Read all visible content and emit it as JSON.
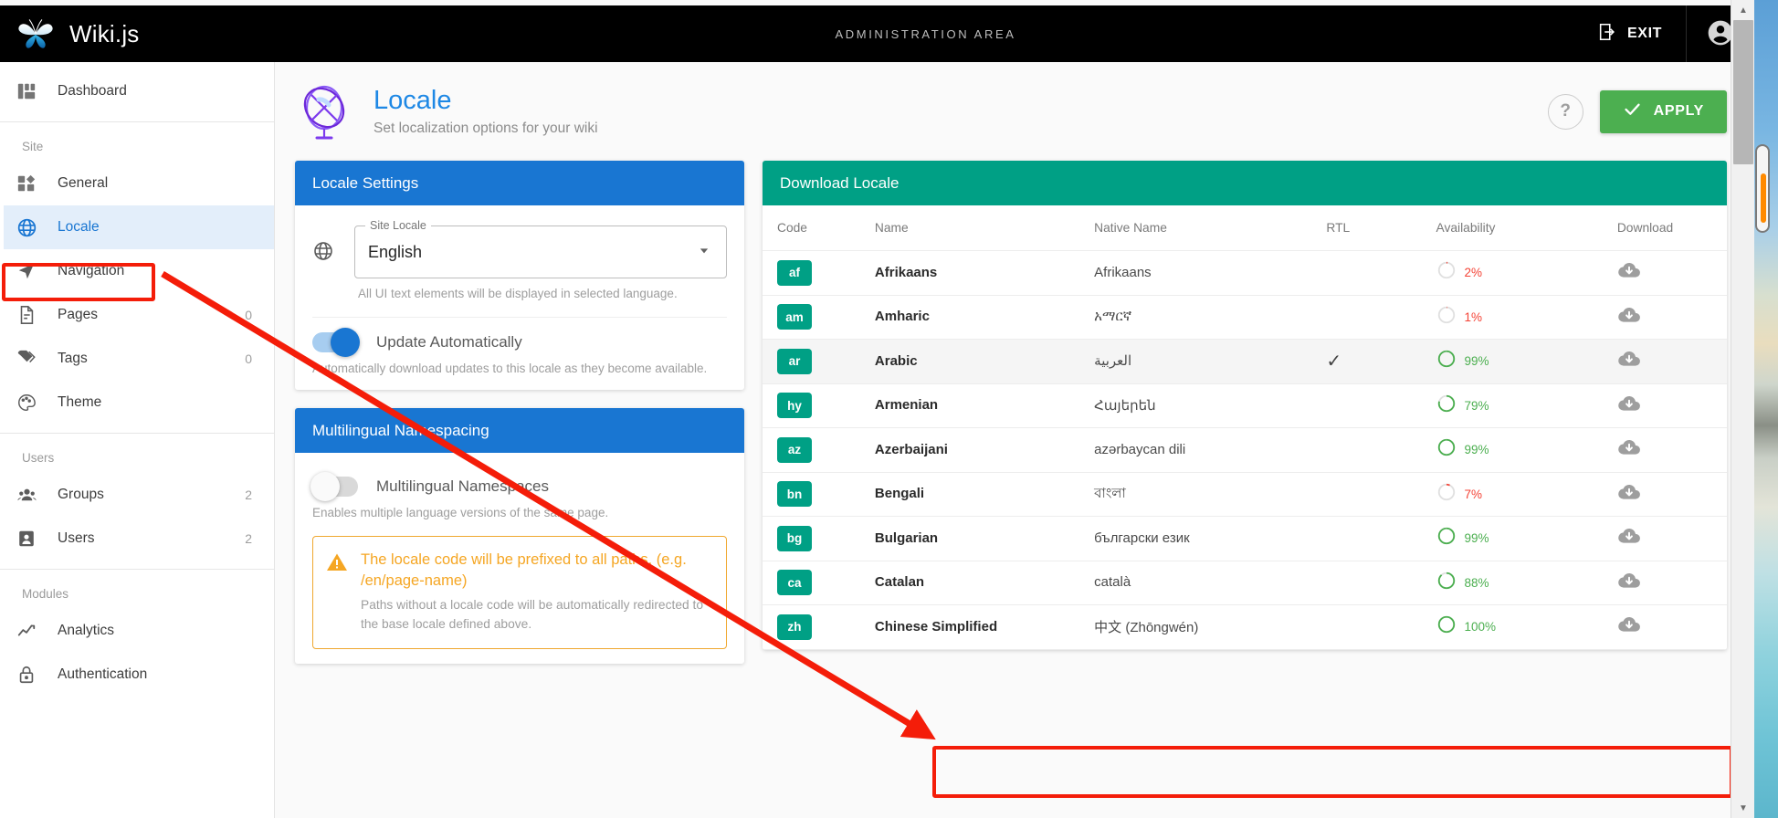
{
  "app": {
    "brand_title": "Wiki.js",
    "admin_area_label": "ADMINISTRATION AREA",
    "exit_label": "EXIT"
  },
  "sidebar": {
    "dashboard": {
      "label": "Dashboard"
    },
    "sections": [
      {
        "title": "Site",
        "items": [
          {
            "label": "General",
            "icon": "general-icon",
            "count": ""
          },
          {
            "label": "Locale",
            "icon": "globe-icon",
            "count": "",
            "active": true
          },
          {
            "label": "Navigation",
            "icon": "navigation-icon",
            "count": ""
          },
          {
            "label": "Pages",
            "icon": "pages-icon",
            "count": "0"
          },
          {
            "label": "Tags",
            "icon": "tags-icon",
            "count": "0"
          },
          {
            "label": "Theme",
            "icon": "theme-icon",
            "count": ""
          }
        ]
      },
      {
        "title": "Users",
        "items": [
          {
            "label": "Groups",
            "icon": "groups-icon",
            "count": "2"
          },
          {
            "label": "Users",
            "icon": "user-icon",
            "count": "2"
          }
        ]
      },
      {
        "title": "Modules",
        "items": [
          {
            "label": "Analytics",
            "icon": "analytics-icon",
            "count": ""
          },
          {
            "label": "Authentication",
            "icon": "lock-icon",
            "count": ""
          }
        ]
      }
    ]
  },
  "page": {
    "title": "Locale",
    "subtitle": "Set localization options for your wiki",
    "help_label": "?",
    "apply_label": "APPLY"
  },
  "locale_settings": {
    "card_title": "Locale Settings",
    "site_locale_legend": "Site Locale",
    "site_locale_value": "English",
    "site_locale_hint": "All UI text elements will be displayed in selected language.",
    "update_auto_label": "Update Automatically",
    "update_auto_state": "on",
    "update_auto_hint": "Automatically download updates to this locale as they become available."
  },
  "multilingual": {
    "card_title": "Multilingual Namespacing",
    "toggle_label": "Multilingual Namespaces",
    "toggle_state": "off",
    "toggle_hint": "Enables multiple language versions of the same page.",
    "alert_title": "The locale code will be prefixed to all paths. (e.g. /en/page-name)",
    "alert_body": "Paths without a locale code will be automatically redirected to the base locale defined above."
  },
  "download_locale": {
    "card_title": "Download Locale",
    "columns": [
      "Code",
      "Name",
      "Native Name",
      "RTL",
      "Availability",
      "Download"
    ],
    "rows": [
      {
        "code": "af",
        "name": "Afrikaans",
        "native": "Afrikaans",
        "rtl": "",
        "availability": 2,
        "pct": "2%",
        "state": "red"
      },
      {
        "code": "am",
        "name": "Amharic",
        "native": "አማርኛ",
        "rtl": "",
        "availability": 1,
        "pct": "1%",
        "state": "red"
      },
      {
        "code": "ar",
        "name": "Arabic",
        "native": "العربية",
        "rtl": "✓",
        "availability": 99,
        "pct": "99%",
        "state": "green"
      },
      {
        "code": "hy",
        "name": "Armenian",
        "native": "Հայերեն",
        "rtl": "",
        "availability": 79,
        "pct": "79%",
        "state": "green"
      },
      {
        "code": "az",
        "name": "Azerbaijani",
        "native": "azərbaycan dili",
        "rtl": "",
        "availability": 99,
        "pct": "99%",
        "state": "green"
      },
      {
        "code": "bn",
        "name": "Bengali",
        "native": "বাংলা",
        "rtl": "",
        "availability": 7,
        "pct": "7%",
        "state": "red"
      },
      {
        "code": "bg",
        "name": "Bulgarian",
        "native": "български език",
        "rtl": "",
        "availability": 99,
        "pct": "99%",
        "state": "green"
      },
      {
        "code": "ca",
        "name": "Catalan",
        "native": "català",
        "rtl": "",
        "availability": 88,
        "pct": "88%",
        "state": "green"
      },
      {
        "code": "zh",
        "name": "Chinese Simplified",
        "native": "中文 (Zhōngwén)",
        "rtl": "",
        "availability": 100,
        "pct": "100%",
        "state": "green",
        "highlighted": true
      }
    ]
  },
  "colors": {
    "brand_bar": "#000000",
    "accent_blue": "#1976d2",
    "accent_teal": "#00a085",
    "apply_green": "#4caf50",
    "alert_orange": "#f5a623",
    "annotation_red": "#f41d09"
  }
}
